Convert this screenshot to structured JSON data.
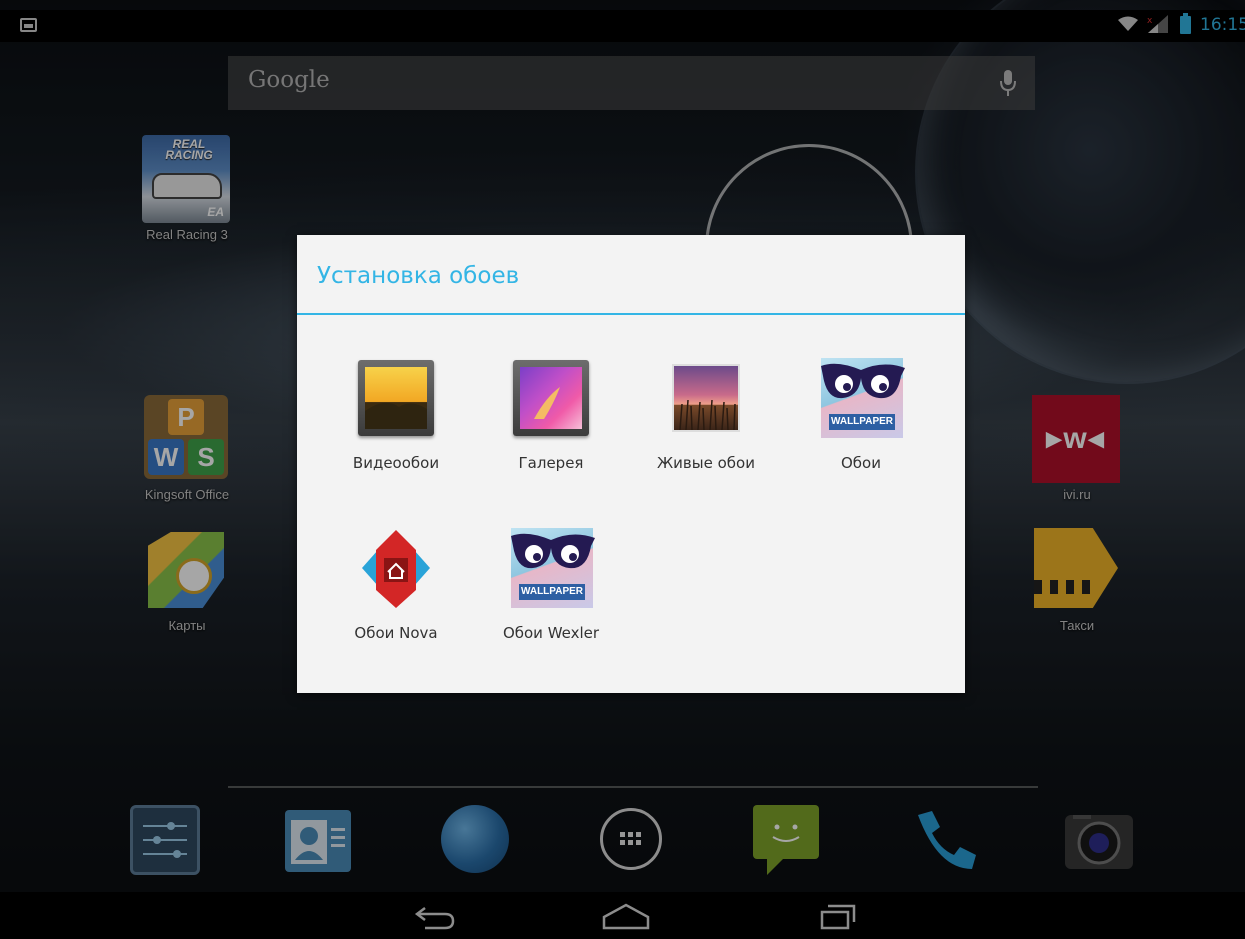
{
  "status_bar": {
    "time": "16:15",
    "icons": [
      "gallery-notification-icon",
      "wifi-icon",
      "signal-icon",
      "battery-icon"
    ]
  },
  "search": {
    "label": "Google",
    "icons": [
      "mic-icon"
    ]
  },
  "desktop_apps": [
    {
      "label": "Real Racing 3",
      "icon": "real-racing-icon",
      "logo_text": "REAL RACING",
      "badge": "EA"
    },
    {
      "label": "Kingsoft Office",
      "icon": "kingsoft-office-icon",
      "letters": [
        "P",
        "W",
        "S"
      ]
    },
    {
      "label": "Карты",
      "icon": "maps-icon"
    },
    {
      "label": "ivi.ru",
      "icon": "ivi-icon"
    },
    {
      "label": "Такси",
      "icon": "taxi-icon"
    }
  ],
  "dialog": {
    "title": "Установка обоев",
    "items": [
      {
        "label": "Видеообои",
        "icon": "video-wallpaper-icon"
      },
      {
        "label": "Галерея",
        "icon": "gallery-icon"
      },
      {
        "label": "Живые обои",
        "icon": "live-wallpaper-icon"
      },
      {
        "label": "Обои",
        "icon": "wallpaper-icon",
        "badge": "WALLPAPER"
      },
      {
        "label": "Обои Nova",
        "icon": "nova-wallpaper-icon"
      },
      {
        "label": "Обои Wexler",
        "icon": "wexler-wallpaper-icon",
        "badge": "WALLPAPER"
      }
    ]
  },
  "dock": [
    {
      "icon": "settings-icon"
    },
    {
      "icon": "contacts-icon"
    },
    {
      "icon": "browser-icon"
    },
    {
      "icon": "all-apps-icon"
    },
    {
      "icon": "messaging-icon"
    },
    {
      "icon": "phone-icon"
    },
    {
      "icon": "camera-icon"
    }
  ],
  "nav_bar": {
    "buttons": [
      "back-icon",
      "home-icon",
      "recent-apps-icon"
    ]
  },
  "colors": {
    "accent": "#33b5e5",
    "dialog_bg": "#f3f3f3",
    "status_bar_bg": "#000000"
  }
}
